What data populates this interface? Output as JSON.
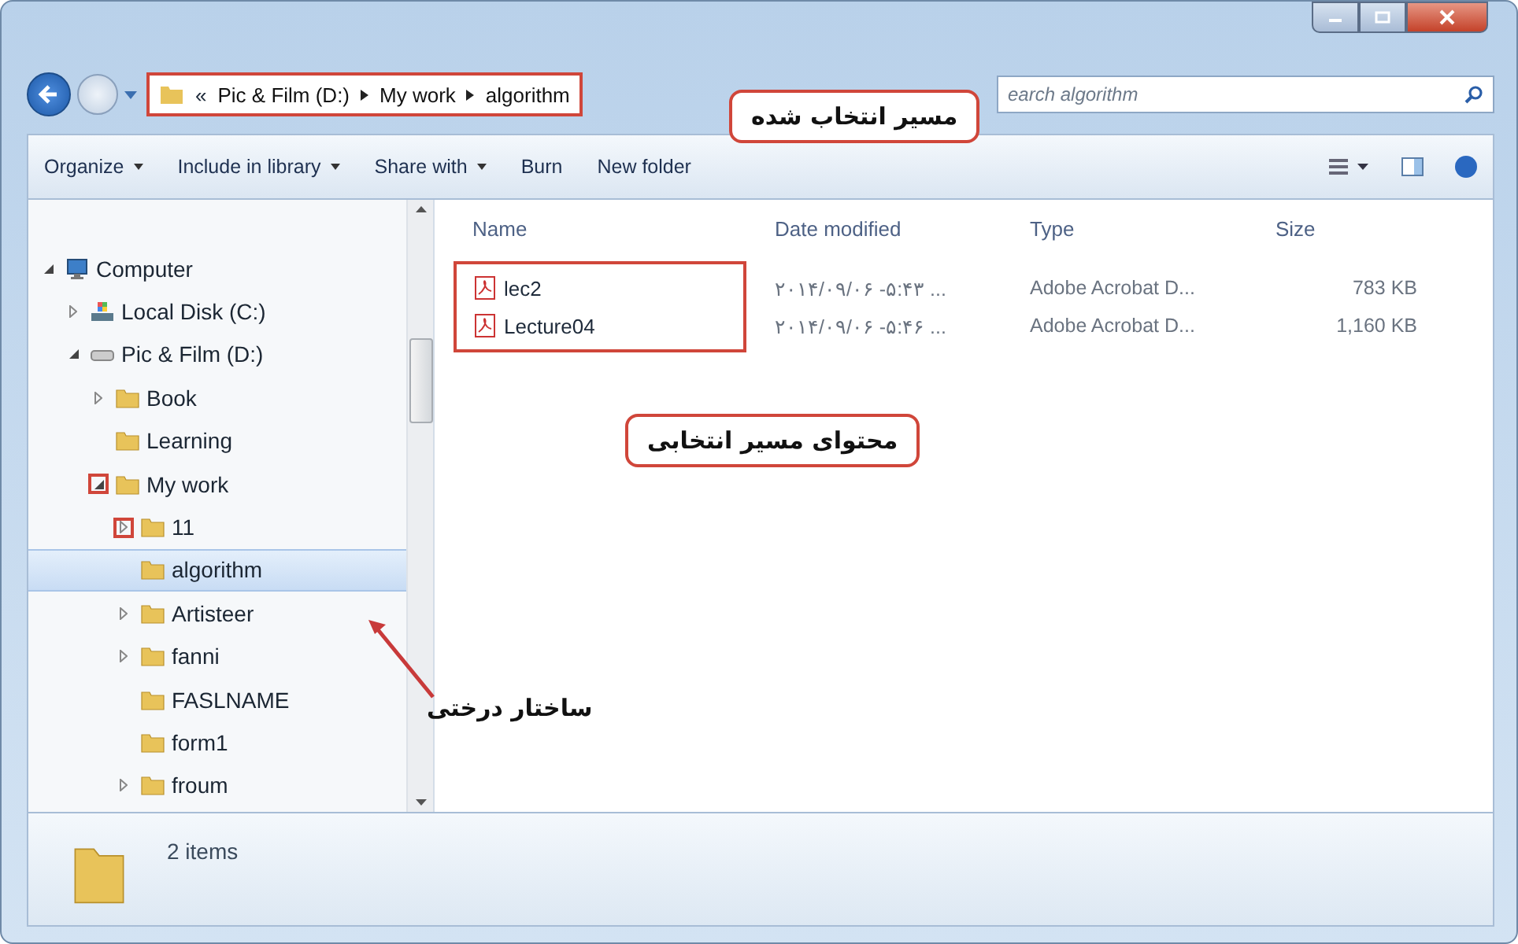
{
  "address_bar": {
    "overflow": "«",
    "crumbs": [
      "Pic & Film (D:)",
      "My work",
      "algorithm"
    ],
    "annotated": true
  },
  "search": {
    "placeholder": "earch algorithm"
  },
  "toolbar": {
    "items": [
      {
        "label": "Organize",
        "menu": true
      },
      {
        "label": "Include in library",
        "menu": true
      },
      {
        "label": "Share with",
        "menu": true
      },
      {
        "label": "Burn",
        "menu": false
      },
      {
        "label": "New folder",
        "menu": false
      }
    ]
  },
  "tree": [
    {
      "label": "Computer",
      "kind": "computer",
      "expanded": true,
      "selected": false,
      "annotated": false,
      "children": [
        {
          "label": "Local Disk (C:)",
          "kind": "system-drive",
          "expanded": false,
          "selected": false,
          "annotated": false
        },
        {
          "label": "Pic & Film (D:)",
          "kind": "drive",
          "expanded": true,
          "selected": false,
          "annotated": false,
          "children": [
            {
              "label": "Book",
              "kind": "folder",
              "expanded": false,
              "selected": false,
              "annotated": false
            },
            {
              "label": "Learning",
              "kind": "folder",
              "selected": false,
              "annotated": false
            },
            {
              "label": "My work",
              "kind": "folder",
              "expanded": true,
              "selected": false,
              "annotated": true,
              "children": [
                {
                  "label": "11",
                  "kind": "folder",
                  "expanded": false,
                  "selected": false,
                  "annotated": true
                },
                {
                  "label": "algorithm",
                  "kind": "folder",
                  "selected": true,
                  "annotated": false
                },
                {
                  "label": "Artisteer",
                  "kind": "folder",
                  "expanded": false,
                  "selected": false,
                  "annotated": false
                },
                {
                  "label": "fanni",
                  "kind": "folder",
                  "expanded": false,
                  "selected": false,
                  "annotated": false
                },
                {
                  "label": "FASLNAME",
                  "kind": "folder",
                  "selected": false,
                  "annotated": false
                },
                {
                  "label": "form1",
                  "kind": "folder",
                  "selected": false,
                  "annotated": false
                },
                {
                  "label": "froum",
                  "kind": "folder",
                  "expanded": false,
                  "selected": false,
                  "annotated": false
                }
              ]
            }
          ]
        }
      ]
    }
  ],
  "files": {
    "columns": [
      "Name",
      "Date modified",
      "Type",
      "Size"
    ],
    "annotated": true,
    "rows": [
      {
        "name": "lec2",
        "date": "۲۰۱۴/۰۹/۰۶ -۵:۴۳ ...",
        "type": "Adobe Acrobat D...",
        "size": "783 KB"
      },
      {
        "name": "Lecture04",
        "date": "۲۰۱۴/۰۹/۰۶ -۵:۴۶ ...",
        "type": "Adobe Acrobat D...",
        "size": "1,160 KB"
      }
    ]
  },
  "details": {
    "count": "2 items"
  },
  "callouts": [
    {
      "kind": "address",
      "text": "مسیر انتخاب شده"
    },
    {
      "kind": "files",
      "text": "محتوای مسیر انتخابی"
    },
    {
      "kind": "tree",
      "text": "ساختار درختی"
    }
  ]
}
